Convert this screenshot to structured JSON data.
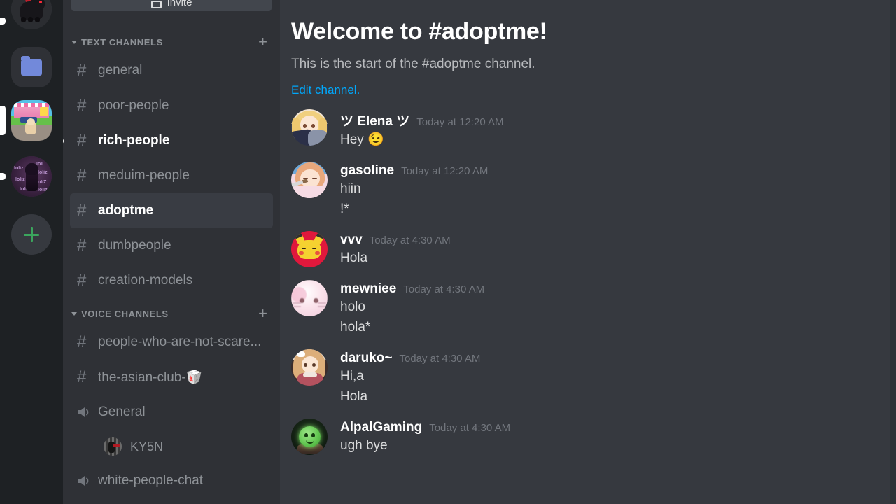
{
  "server_rail": {
    "servers": [
      {
        "name": "adopt-me-horse-server",
        "icon": "horse-icon",
        "unread": true,
        "active": false
      },
      {
        "name": "server-folder",
        "icon": "folder-icon",
        "unread": false,
        "active": false
      },
      {
        "name": "roblox-adopt-me-server",
        "icon": "roblox-screenshot-icon",
        "unread": false,
        "active": true
      },
      {
        "name": "loliz-server",
        "icon": "loliz-avatar-icon",
        "unread": true,
        "active": false
      }
    ],
    "add_server_label": "+"
  },
  "sidebar": {
    "invite_button_label": "Invite",
    "categories": [
      {
        "name": "TEXT CHANNELS",
        "add_label": "+",
        "channels": [
          {
            "name": "general",
            "type": "text",
            "state": "normal"
          },
          {
            "name": "poor-people",
            "type": "text",
            "state": "normal"
          },
          {
            "name": "rich-people",
            "type": "text",
            "state": "unread"
          },
          {
            "name": "meduim-people",
            "type": "text",
            "state": "normal"
          },
          {
            "name": "adoptme",
            "type": "text",
            "state": "active"
          },
          {
            "name": "dumbpeople",
            "type": "text",
            "state": "normal"
          },
          {
            "name": "creation-models",
            "type": "text",
            "state": "normal"
          }
        ]
      },
      {
        "name": "VOICE CHANNELS",
        "add_label": "+",
        "channels": [
          {
            "name": "people-who-are-not-scare...",
            "type": "text",
            "state": "normal"
          },
          {
            "name": "the-asian-club-🥡",
            "type": "text",
            "state": "normal"
          },
          {
            "name": "General",
            "type": "voice",
            "state": "normal",
            "members": [
              {
                "name": "KY5N"
              }
            ]
          },
          {
            "name": "white-people-chat",
            "type": "voice",
            "state": "normal"
          }
        ]
      }
    ]
  },
  "main": {
    "welcome_title": "Welcome to #adoptme!",
    "welcome_subtitle": "This is the start of the #adoptme channel.",
    "edit_channel_link": "Edit channel.",
    "messages": [
      {
        "author": "ツ Elena ツ",
        "timestamp": "Today at 12:20 AM",
        "avatar": "elena-avatar",
        "lines": [
          "Hey 😉"
        ]
      },
      {
        "author": "gasoline",
        "timestamp": "Today at 12:20 AM",
        "avatar": "gasoline-avatar",
        "lines": [
          "hiin",
          "!*"
        ]
      },
      {
        "author": "vvv",
        "timestamp": "Today at 4:30 AM",
        "avatar": "vvv-avatar",
        "lines": [
          "Hola"
        ]
      },
      {
        "author": "mewniee",
        "timestamp": "Today at 4:30 AM",
        "avatar": "mewniee-avatar",
        "lines": [
          "holo",
          "hola*"
        ]
      },
      {
        "author": "daruko~",
        "timestamp": "Today at 4:30 AM",
        "avatar": "daruko-avatar",
        "lines": [
          "Hi,a",
          "Hola"
        ]
      },
      {
        "author": "AlpalGaming",
        "timestamp": "Today at 4:30 AM",
        "avatar": "alpalgaming-avatar",
        "lines": [
          "ugh bye"
        ]
      }
    ]
  },
  "colors": {
    "rail_bg": "#1e2124",
    "sidebar_bg": "#2f3136",
    "main_bg": "#36393f",
    "channel_active_bg": "#393c43",
    "text_muted": "#8e9297",
    "text_normal": "#dcddde",
    "link": "#00a8fc",
    "accent_green": "#3ba55d"
  }
}
